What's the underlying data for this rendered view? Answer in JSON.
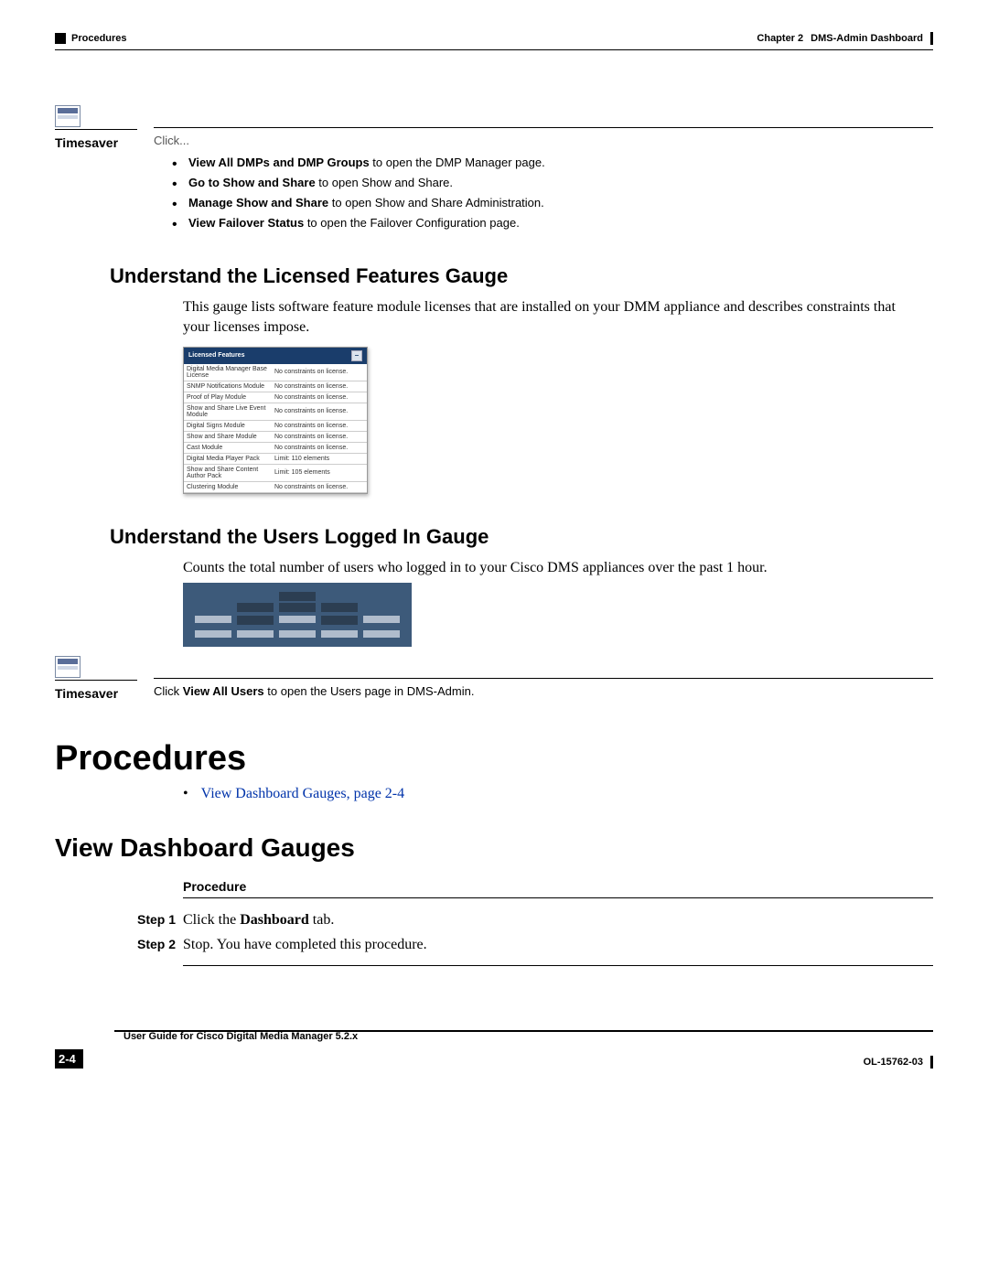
{
  "header": {
    "section_left": "Procedures",
    "chapter_label": "Chapter 2",
    "chapter_title": "DMS-Admin Dashboard"
  },
  "timesaver1": {
    "label": "Timesaver",
    "click": "Click...",
    "items": [
      {
        "bold": "View All DMPs and DMP Groups",
        "rest": " to open the DMP Manager page."
      },
      {
        "bold": "Go to Show and Share",
        "rest": " to open Show and Share."
      },
      {
        "bold": "Manage Show and Share",
        "rest": " to open Show and Share Administration."
      },
      {
        "bold": "View Failover Status",
        "rest": " to open the Failover Configuration page."
      }
    ]
  },
  "licensed": {
    "heading": "Understand the Licensed Features Gauge",
    "body": "This gauge lists software feature module licenses that are installed on your DMM appliance and describes constraints that your licenses impose.",
    "widget_title": "Licensed Features",
    "rows": [
      {
        "name": "Digital Media Manager Base License",
        "value": "No constraints on license."
      },
      {
        "name": "SNMP Notifications Module",
        "value": "No constraints on license."
      },
      {
        "name": "Proof of Play Module",
        "value": "No constraints on license."
      },
      {
        "name": "Show and Share Live Event Module",
        "value": "No constraints on license."
      },
      {
        "name": "Digital Signs Module",
        "value": "No constraints on license."
      },
      {
        "name": "Show and Share Module",
        "value": "No constraints on license."
      },
      {
        "name": "Cast Module",
        "value": "No constraints on license."
      },
      {
        "name": "Digital Media Player Pack",
        "value": "Limit: 110 elements"
      },
      {
        "name": "Show and Share Content Author Pack",
        "value": "Limit: 105 elements"
      },
      {
        "name": "Clustering Module",
        "value": "No constraints on license."
      }
    ]
  },
  "users": {
    "heading": "Understand the Users Logged In Gauge",
    "body": "Counts the total number of users who logged in to your Cisco DMS appliances over the past 1 hour."
  },
  "timesaver2": {
    "label": "Timesaver",
    "pre": "Click ",
    "bold": "View All Users",
    "post": " to open the Users page in DMS-Admin."
  },
  "procedures": {
    "heading": "Procedures",
    "link": "View Dashboard Gauges, page 2-4"
  },
  "view_gauges": {
    "heading": "View Dashboard Gauges",
    "procedure_label": "Procedure",
    "steps": [
      {
        "label": "Step 1",
        "pre": "Click the ",
        "bold": "Dashboard",
        "post": " tab."
      },
      {
        "label": "Step 2",
        "pre": "Stop. You have completed this procedure.",
        "bold": "",
        "post": ""
      }
    ]
  },
  "footer": {
    "guide": "User Guide for Cisco Digital Media Manager 5.2.x",
    "page": "2-4",
    "docnum": "OL-15762-03"
  }
}
